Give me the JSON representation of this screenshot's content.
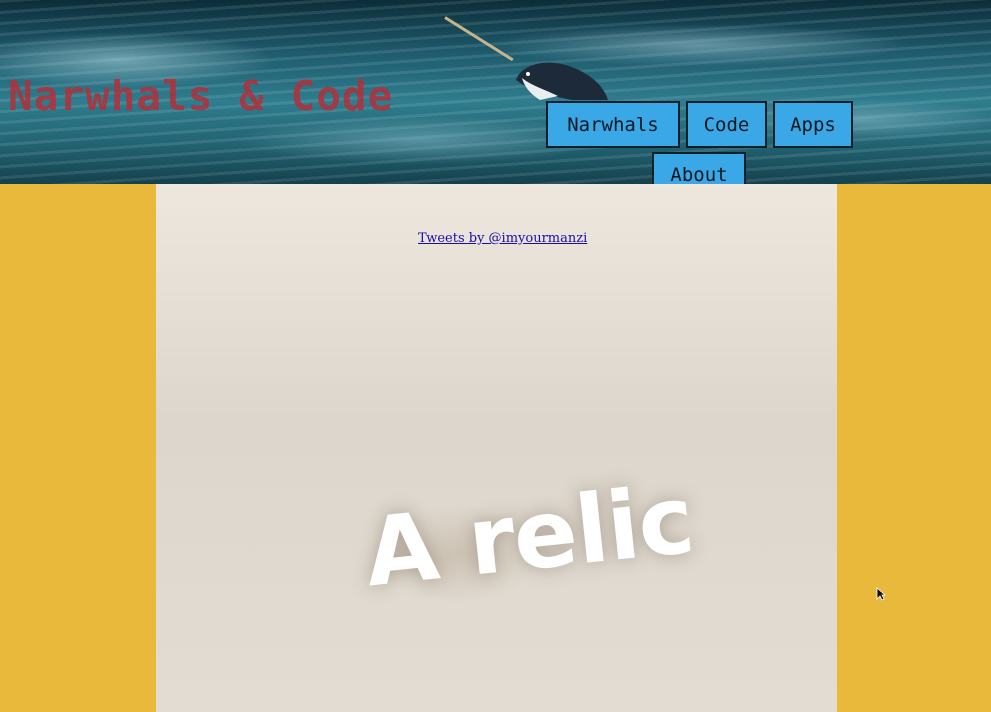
{
  "site": {
    "title": "Narwhals & Code"
  },
  "nav": {
    "narwhals": "Narwhals",
    "code": "Code",
    "apps": "Apps",
    "about": "About"
  },
  "main": {
    "tweets_link": "Tweets by @imyourmanzi"
  },
  "overlay": {
    "caption": "A relic"
  },
  "icons": {
    "narwhal": "narwhal-icon",
    "cursor": "mouse-cursor-icon"
  },
  "colors": {
    "side_background": "#e8b93a",
    "content_background": "#e5dfd5",
    "nav_button": "#3aa8e6",
    "title_text": "#b3303a",
    "link": "#1a0dab"
  }
}
